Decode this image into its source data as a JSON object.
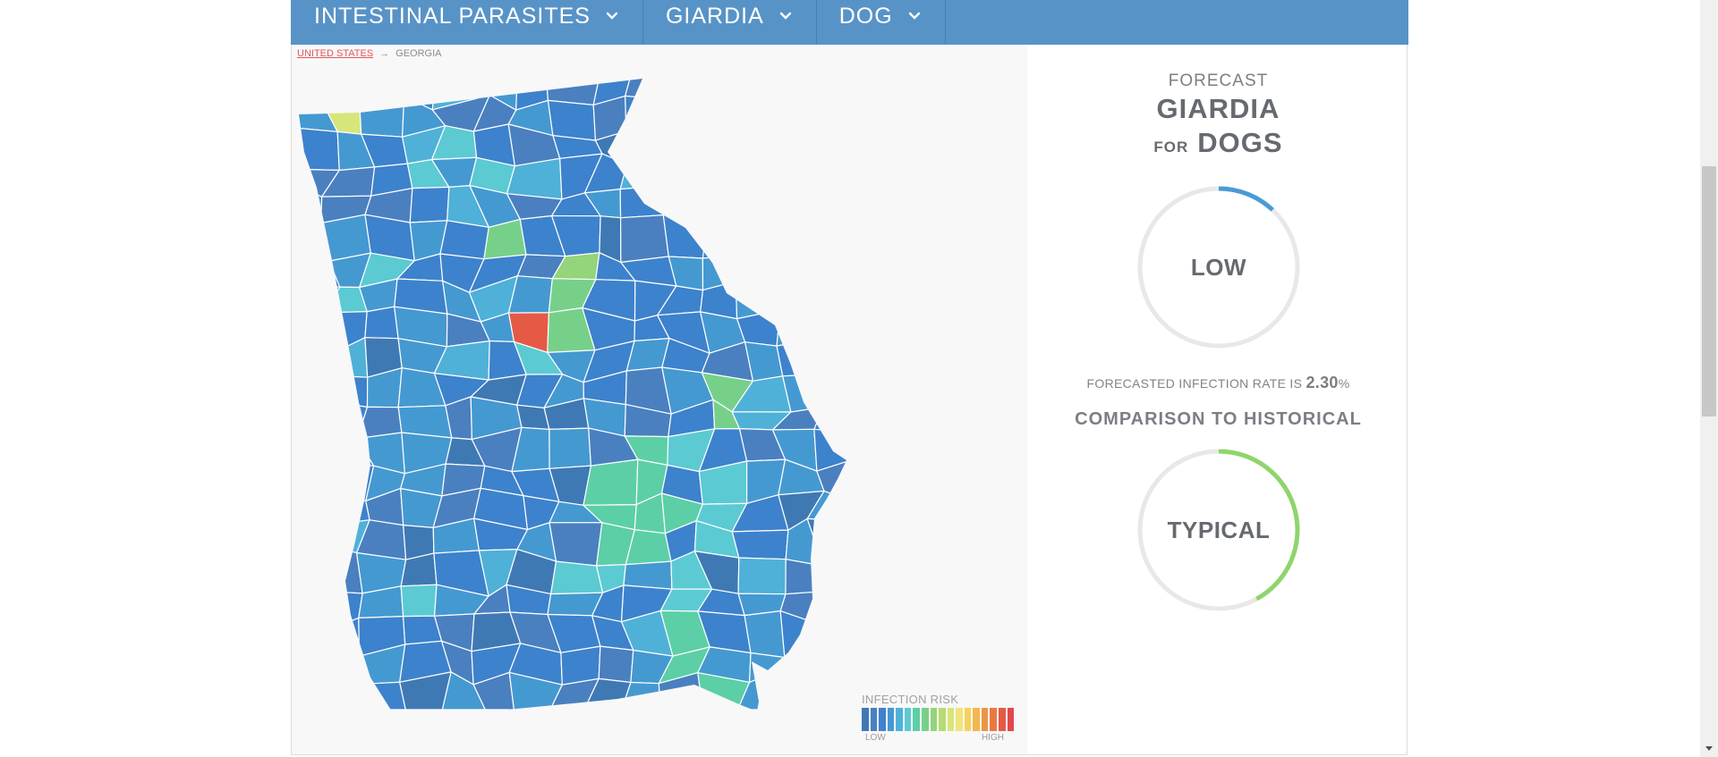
{
  "nav": {
    "items": [
      {
        "label": "INTESTINAL PARASITES"
      },
      {
        "label": "GIARDIA"
      },
      {
        "label": "DOG"
      }
    ]
  },
  "breadcrumb": {
    "root": "UNITED STATES",
    "separator": "→",
    "current": "GEORGIA"
  },
  "legend": {
    "title": "INFECTION RISK",
    "low_label": "LOW",
    "high_label": "HIGH",
    "colors": [
      "#3f79b4",
      "#4a80c0",
      "#3d82cc",
      "#4599d1",
      "#4fb1d8",
      "#5ccad3",
      "#5ccfa6",
      "#77d08a",
      "#94d47a",
      "#b6db72",
      "#d8e57a",
      "#f2e47a",
      "#f4d160",
      "#f0b84e",
      "#eb9644",
      "#e87a41",
      "#e55a45",
      "#e24848"
    ]
  },
  "forecast": {
    "label": "FORECAST",
    "disease": "GIARDIA",
    "for_word": "FOR",
    "species": "DOGS",
    "risk_level": "LOW",
    "risk_fraction": 0.12,
    "risk_color": "#4a9ad6",
    "rate_prefix": "FORECASTED INFECTION RATE IS",
    "rate_value": "2.30",
    "rate_unit": "%"
  },
  "comparison": {
    "title": "COMPARISON TO HISTORICAL",
    "level": "TYPICAL",
    "fraction": 0.42,
    "color": "#8fd56b"
  },
  "colors": {
    "nav_bg": "#5893c7",
    "gauge_track": "#e8e8e8",
    "map_bg": "#f8f8f8"
  }
}
